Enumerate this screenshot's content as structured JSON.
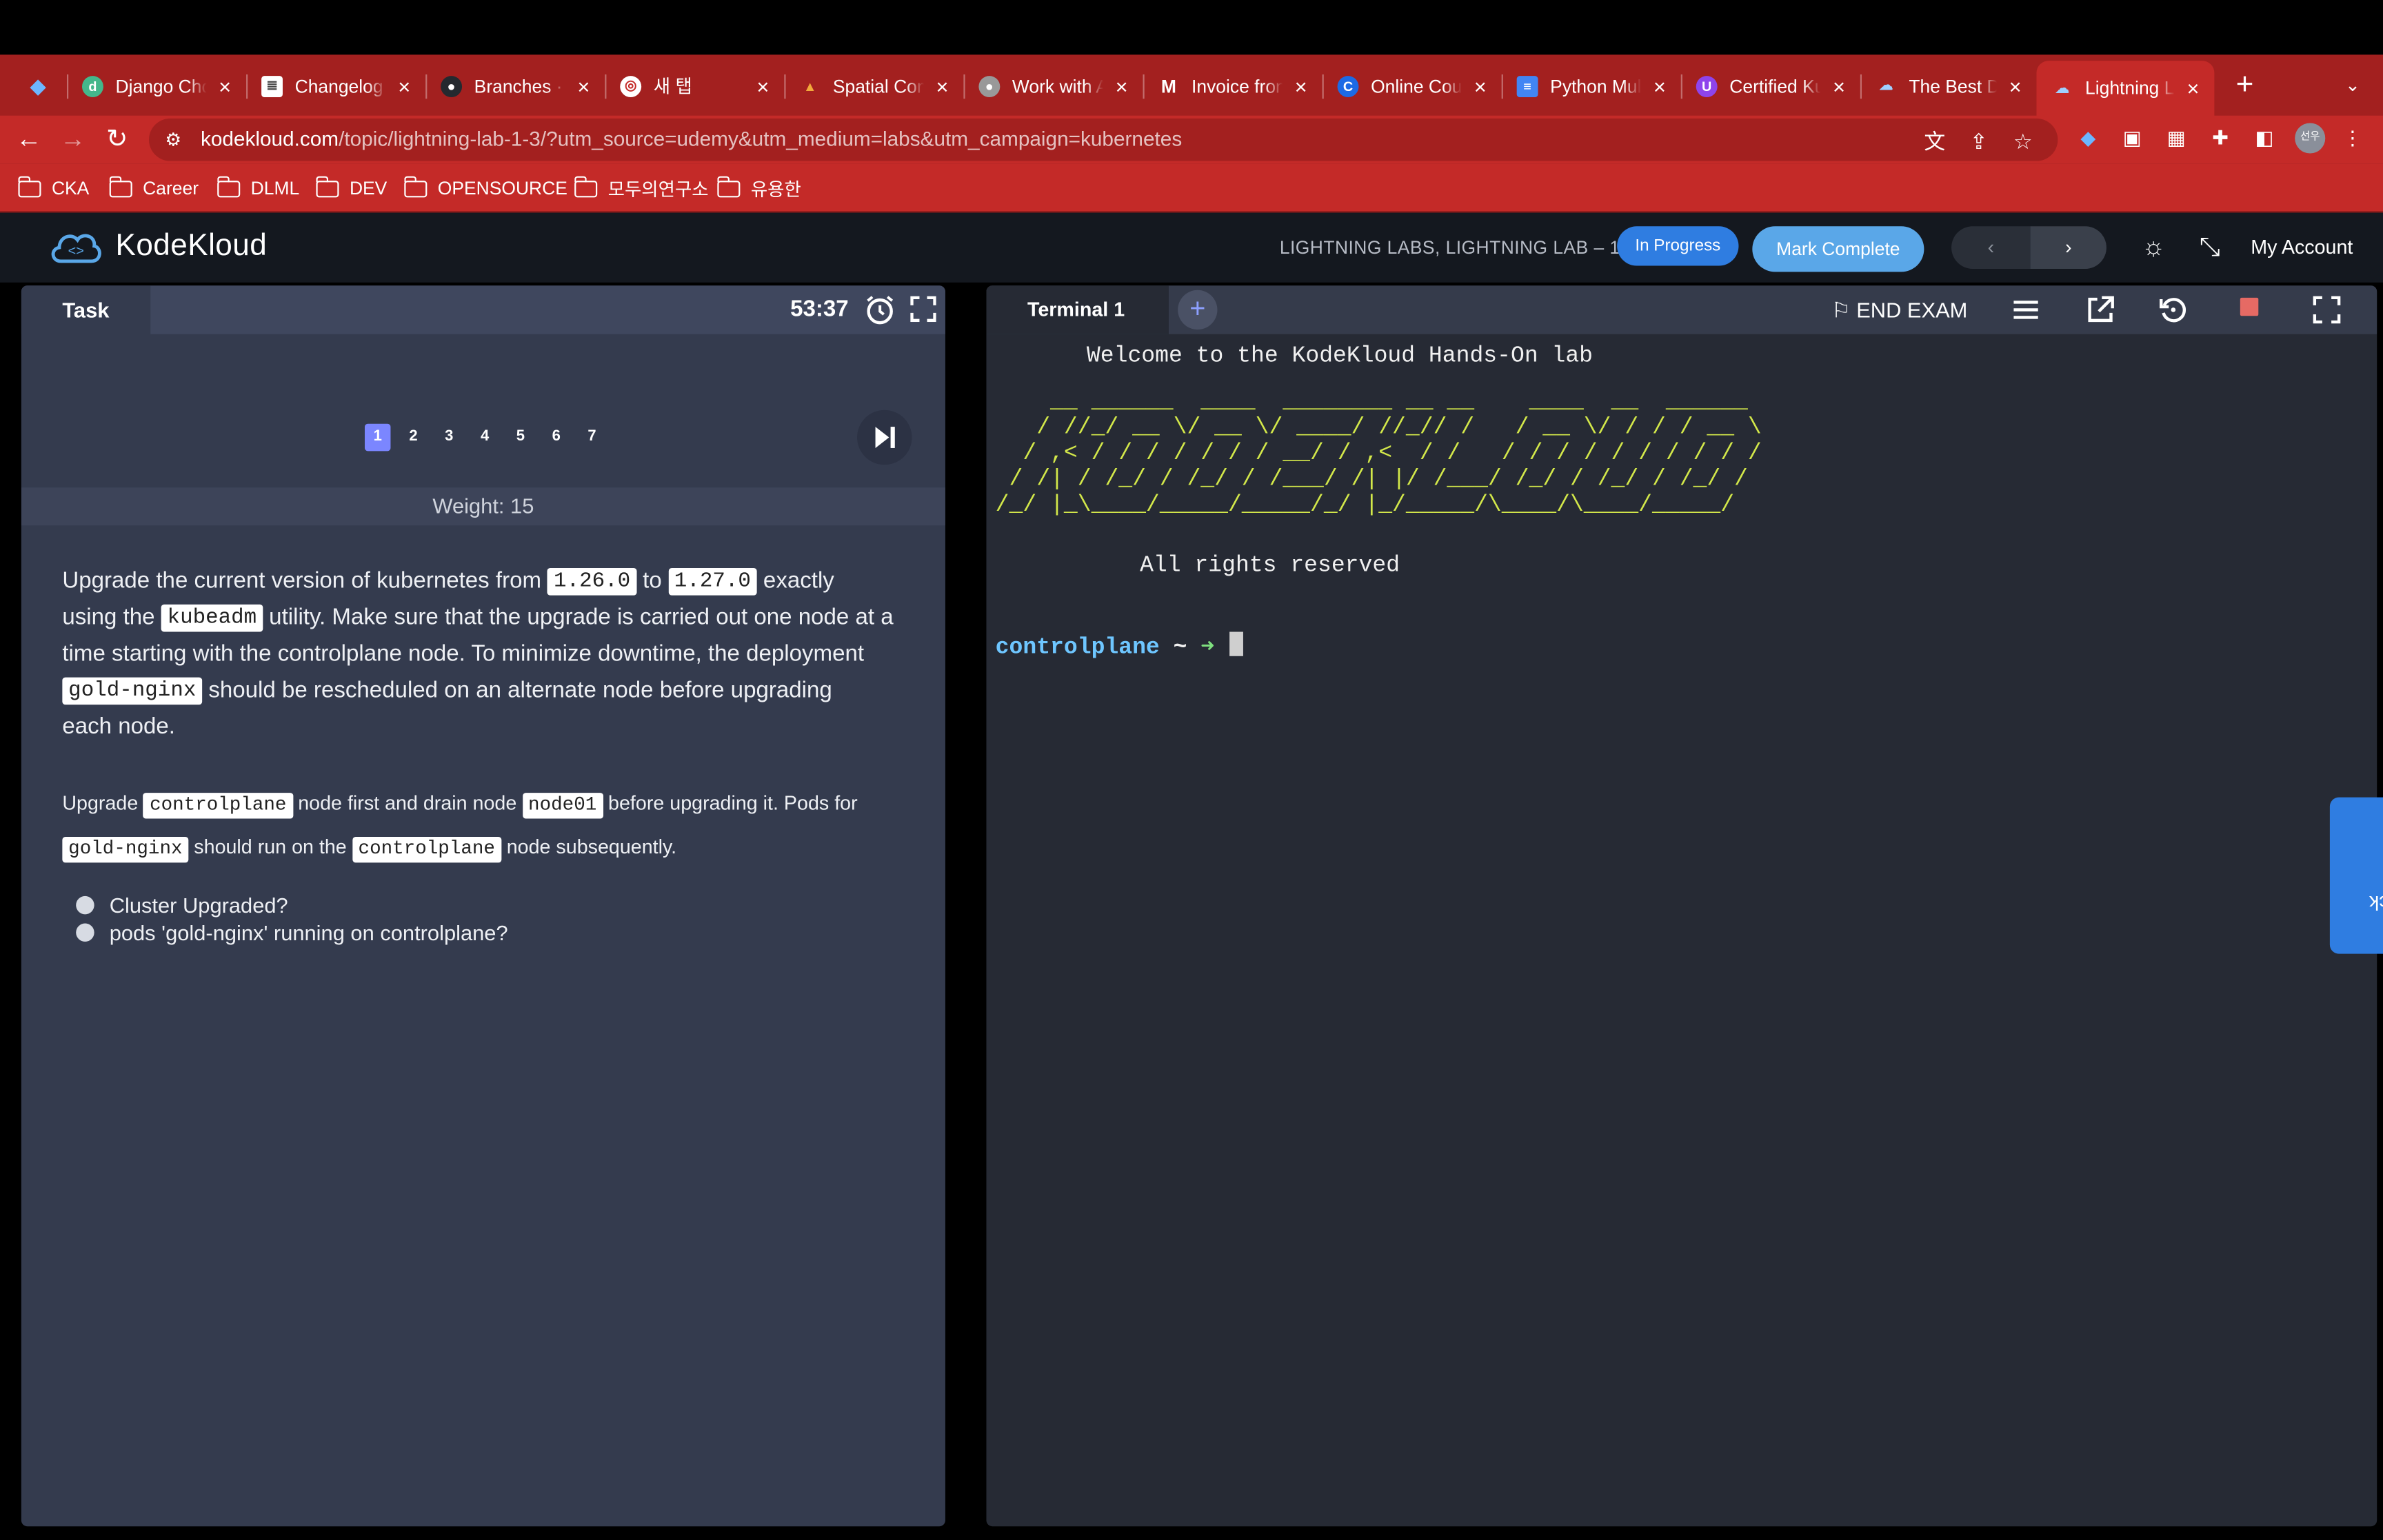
{
  "browser": {
    "tabs": [
      {
        "title": "",
        "favicon_color": "#2f7de1",
        "icon": "gem-icon"
      },
      {
        "title": "Django Cho",
        "favicon_color": "#44b78b",
        "icon": "django-icon"
      },
      {
        "title": "Changelog",
        "favicon_color": "#ffffff",
        "icon": "doc-icon"
      },
      {
        "title": "Branches ·",
        "favicon_color": "#24292f",
        "icon": "github-icon"
      },
      {
        "title": "새 탭",
        "favicon_color": "#ffffff",
        "icon": "chrome-icon"
      },
      {
        "title": "Spatial Com",
        "favicon_color": "#f2a93b",
        "icon": "pyramid-icon"
      },
      {
        "title": "Work with A",
        "favicon_color": "#999999",
        "icon": "apple-icon"
      },
      {
        "title": "Invoice fron",
        "favicon_color": "#ea4335",
        "icon": "gmail-icon"
      },
      {
        "title": "Online Cour",
        "favicon_color": "#1d6ae5",
        "icon": "coursera-icon"
      },
      {
        "title": "Python Mul",
        "favicon_color": "#4285f4",
        "icon": "docs-icon"
      },
      {
        "title": "Certified Ku",
        "favicon_color": "#8e44ec",
        "icon": "udemy-icon"
      },
      {
        "title": "The Best D",
        "favicon_color": "#5aa7e8",
        "icon": "kodekloud-icon"
      },
      {
        "title": "Lightning L",
        "favicon_color": "#5aa7e8",
        "icon": "kodekloud-icon"
      }
    ],
    "url_host": "kodekloud.com",
    "url_path": "/topic/lightning-lab-1-3/?utm_source=udemy&utm_medium=labs&utm_campaign=kubernetes",
    "bookmarks": [
      "CKA",
      "Career",
      "DLML",
      "DEV",
      "OPENSOURCE",
      "모두의연구소",
      "유용한"
    ],
    "avatar_text": "선우"
  },
  "app": {
    "brand": "KodeKloud",
    "breadcrumb": "LIGHTNING LABS, LIGHTNING LAB – 1",
    "status": "In Progress",
    "mark_complete": "Mark Complete",
    "account": "My Account",
    "prev_glyph": "‹",
    "next_glyph": "›"
  },
  "task": {
    "tab_label": "Task",
    "timer": "53:37",
    "steps": [
      "1",
      "2",
      "3",
      "4",
      "5",
      "6",
      "7"
    ],
    "current_step": "1",
    "weight": "Weight: 15",
    "p1": {
      "t1": "Upgrade the current version of kubernetes from ",
      "c1": "1.26.0",
      "t2": " to ",
      "c2": "1.27.0",
      "t3": " exactly using the ",
      "c3": "kubeadm",
      "t4": " utility. Make sure that the upgrade is carried out one node at a time starting with the controlplane node. To minimize downtime, the deployment ",
      "c4": "gold-nginx",
      "t5": " should be rescheduled on an alternate node before upgrading each node."
    },
    "p2": {
      "t1": "Upgrade ",
      "c1": "controlplane",
      "t2": " node first and drain node ",
      "c2": "node01",
      "t3": " before upgrading it. Pods for ",
      "c3": "gold-nginx",
      "t4": " should run on the ",
      "c4": "controlplane",
      "t5": " node subsequently."
    },
    "checks": [
      "Cluster Upgraded?",
      "pods 'gold-nginx' running on controlplane?"
    ]
  },
  "terminal": {
    "tab_label": "Terminal 1",
    "add_label": "+",
    "end_exam": "END EXAM",
    "welcome": "Welcome to the KodeKloud Hands-On lab",
    "ascii_art": "    __ ______  ____  ________ __ __    ____  __  ______\n   / //_/ __ \\/ __ \\/ ____/ //_// /   / __ \\/ / / / __ \\\n  / ,< / / / / / / / __/ / ,<  / /   / / / / / / / / / /\n / /| / /_/ / /_/ / /___/ /| |/ /___/ /_/ / /_/ / /_/ /\n/_/ |_\\____/_____/_____/_/ |_/_____/\\____/\\____/_____/",
    "rights": "All rights reserved",
    "prompt_host": "controlplane",
    "prompt_rest": " ~ ",
    "prompt_arrow": "➜"
  },
  "feedback": "Feedback",
  "colors": {
    "chrome_red": "#c42a28",
    "accent_blue": "#2f7de1",
    "ascii_yellow": "#d3e84a",
    "prompt_cyan": "#6ec6ff"
  }
}
